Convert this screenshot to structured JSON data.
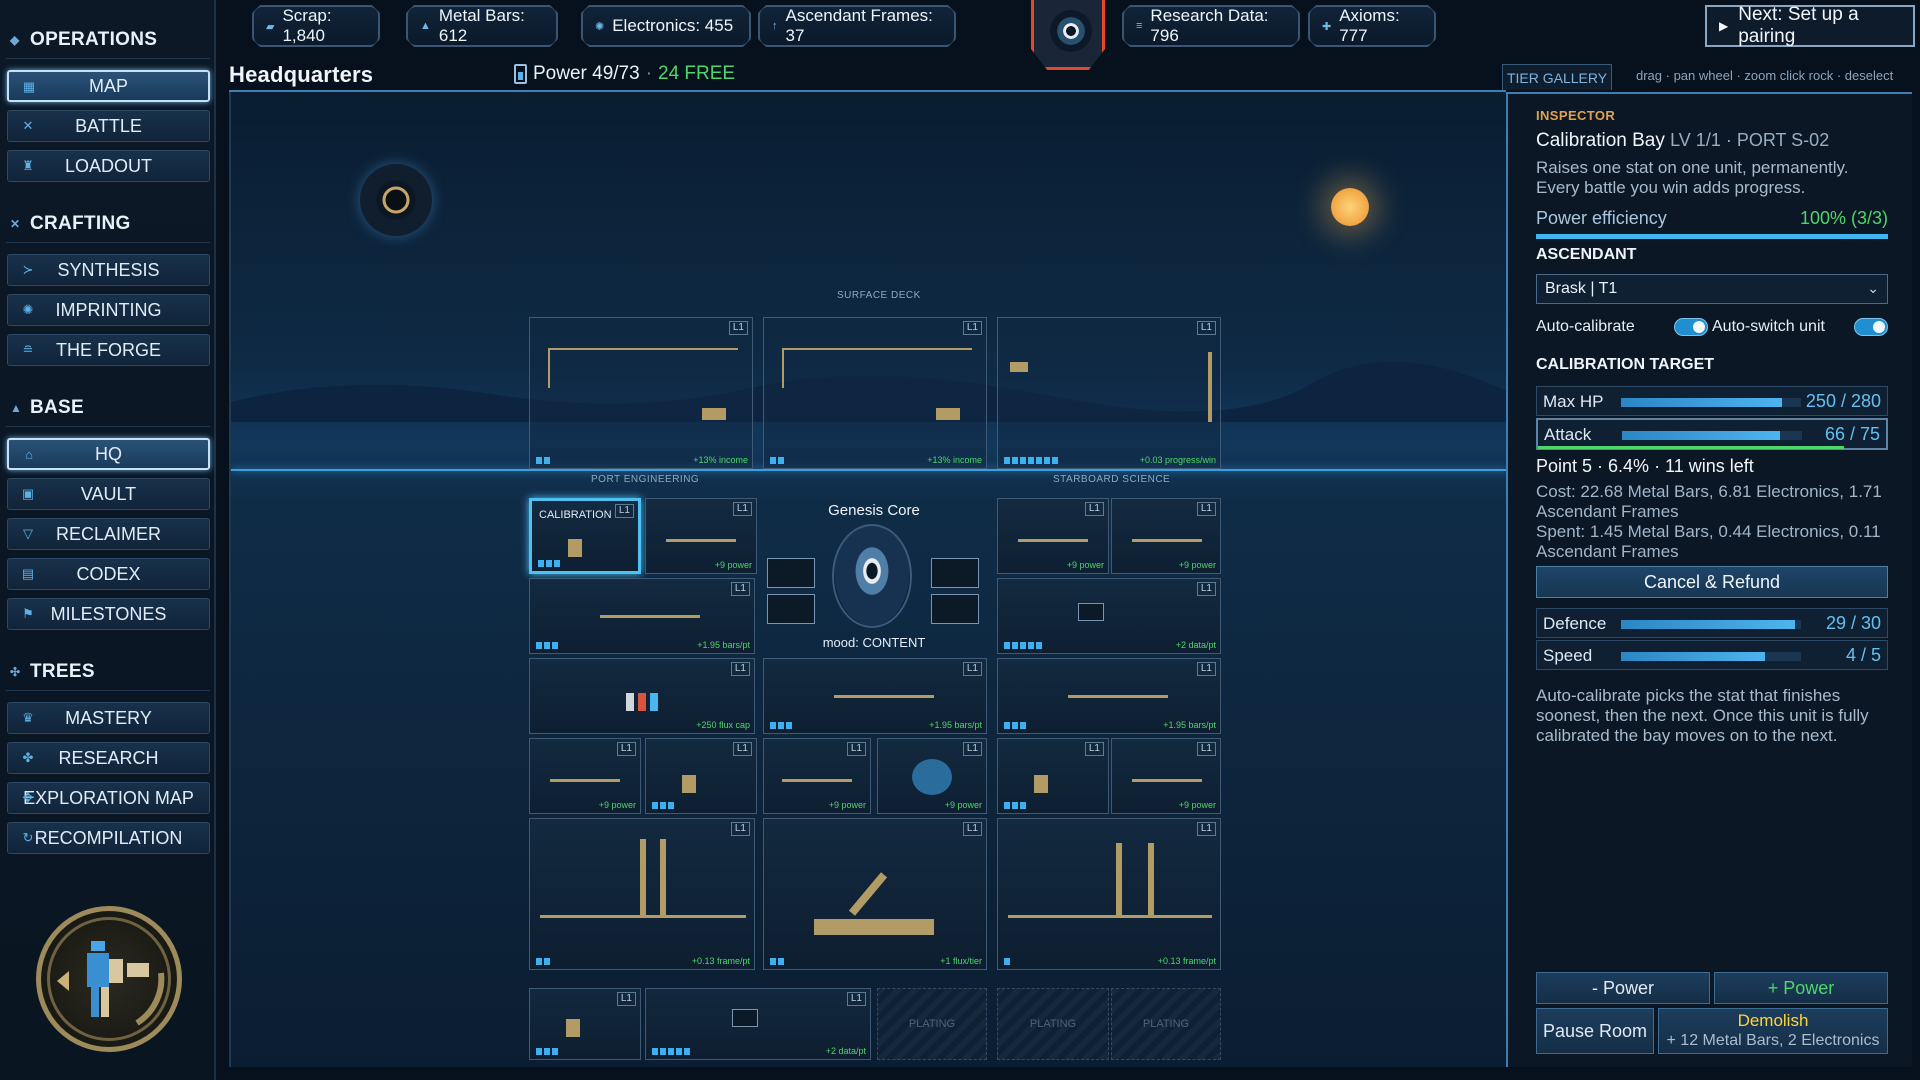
{
  "sidebar": {
    "sections": [
      {
        "title": "OPERATIONS",
        "items": [
          "MAP",
          "BATTLE",
          "LOADOUT"
        ]
      },
      {
        "title": "CRAFTING",
        "items": [
          "SYNTHESIS",
          "IMPRINTING",
          "THE FORGE"
        ]
      },
      {
        "title": "BASE",
        "items": [
          "HQ",
          "VAULT",
          "RECLAIMER",
          "CODEX",
          "MILESTONES"
        ]
      },
      {
        "title": "TREES",
        "items": [
          "MASTERY",
          "RESEARCH",
          "EXPLORATION MAP",
          "RECOMPILATION"
        ]
      }
    ],
    "active_items": [
      "MAP",
      "HQ"
    ]
  },
  "resources": {
    "scrap": "Scrap: 1,840",
    "metal": "Metal Bars: 612",
    "electronics": "Electronics: 455",
    "frames": "Ascendant Frames: 37",
    "research": "Research Data: 796",
    "axioms": "Axioms: 777"
  },
  "next_action": "Next: Set up a pairing",
  "header": {
    "title": "Headquarters",
    "power": "Power 49/73",
    "separator": "·",
    "free": "24 FREE"
  },
  "scene": {
    "zones": {
      "surface": "SURFACE DECK",
      "port": "PORT ENGINEERING",
      "starboard": "STARBOARD SCIENCE"
    },
    "level_tag": "L1",
    "plating_label": "PLATING",
    "calibration_label": "CALIBRATION",
    "genesis": {
      "title": "Genesis Core",
      "mood": "mood: CONTENT"
    },
    "yields": {
      "income": "+13% income",
      "progress": "+0.03 progress/win",
      "power": "+9 power",
      "bars": "+1.95 bars/pt",
      "data": "+2 data/pt",
      "flux_cap": "+250 flux cap",
      "frame": "+0.13 frame/pt",
      "flux_tier": "+1 flux/tier"
    }
  },
  "panel": {
    "tab": "TIER GALLERY",
    "hint": "drag · pan   wheel · zoom   click rock · deselect",
    "inspector_label": "INSPECTOR",
    "room_name": "Calibration Bay",
    "room_meta": "LV 1/1 · PORT S-02",
    "description": "Raises one stat on one unit, permanently. Every battle you win adds progress.",
    "efficiency_label": "Power efficiency",
    "efficiency_value": "100% (3/3)",
    "efficiency_fraction": 1.0,
    "ascendant_head": "ASCENDANT",
    "ascendant_value": "Brask | T1",
    "auto_calibrate": "Auto-calibrate",
    "auto_switch": "Auto-switch unit",
    "target_head": "CALIBRATION TARGET",
    "stats": [
      {
        "name": "Max HP",
        "value": "250 / 280",
        "fraction": 0.893
      },
      {
        "name": "Attack",
        "value": "66 / 75",
        "fraction": 0.88,
        "progress": 0.064
      },
      {
        "name": "Defence",
        "value": "29 / 30",
        "fraction": 0.967
      },
      {
        "name": "Speed",
        "value": "4 / 5",
        "fraction": 0.8
      }
    ],
    "point": "Point 5 · 6.4% · 11 wins left",
    "cost": "Cost: 22.68 Metal Bars, 6.81 Electronics, 1.71 Ascendant Frames",
    "spent": "Spent: 1.45 Metal Bars, 0.44 Electronics, 0.11 Ascendant Frames",
    "cancel": "Cancel & Refund",
    "auto_desc": "Auto-calibrate picks the stat that finishes soonest, then the next. Once this unit is fully calibrated the bay moves on to the next.",
    "minus_power": "- Power",
    "plus_power": "+ Power",
    "pause": "Pause Room",
    "demolish": "Demolish",
    "demolish_refund": "+ 12 Metal Bars, 2 Electronics"
  },
  "colors": {
    "accent": "#3fb6f2",
    "positive": "#4fd66a",
    "warning": "#ffd43a",
    "highlight": "#e2a14d"
  }
}
